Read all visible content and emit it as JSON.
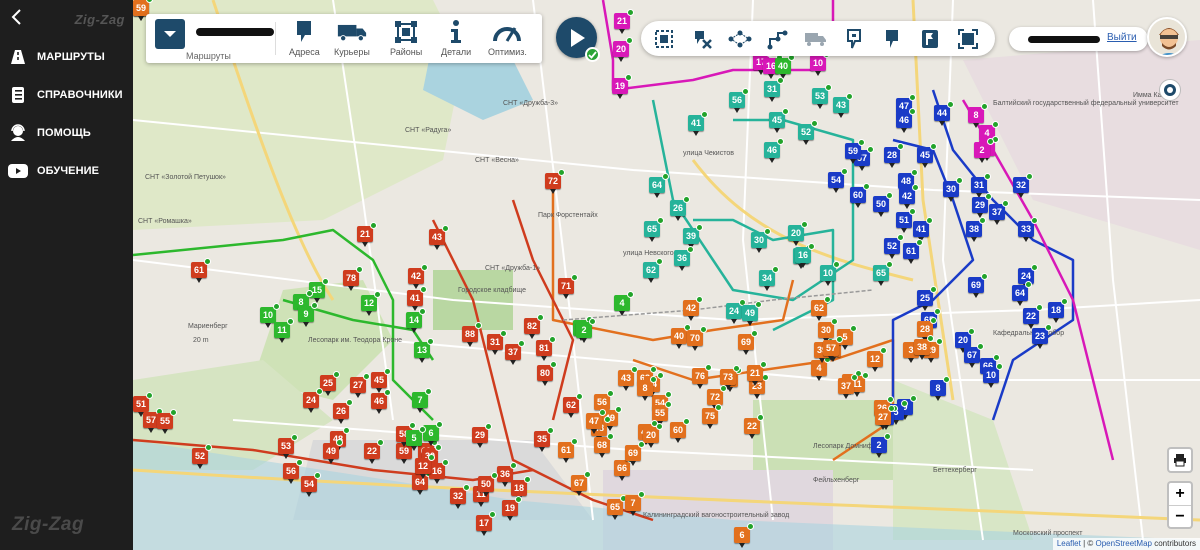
{
  "sidebar": {
    "brand_top": "Zig-Zag",
    "brand_bottom": "Zig-Zag",
    "items": [
      {
        "label": "МАРШРУТЫ",
        "icon": "road-sign-icon"
      },
      {
        "label": "СПРАВОЧНИКИ",
        "icon": "directory-icon"
      },
      {
        "label": "ПОМОЩЬ",
        "icon": "support-icon"
      },
      {
        "label": "ОБУЧЕНИЕ",
        "icon": "video-play-icon"
      }
    ]
  },
  "toolbar": {
    "routes_caption": "Маршруты",
    "buttons": [
      {
        "label": "Адреса",
        "icon": "address-pin-icon"
      },
      {
        "label": "Курьеры",
        "icon": "truck-icon"
      },
      {
        "label": "Районы",
        "icon": "district-icon"
      },
      {
        "label": "Детали",
        "icon": "info-icon"
      },
      {
        "label": "Оптимиз.",
        "icon": "speedometer-icon"
      }
    ]
  },
  "map_tools": [
    "select-area-icon",
    "remove-points-icon",
    "route-graph-icon",
    "route-path-icon",
    "truck-move-icon",
    "pin-outline-icon",
    "pin-filled-icon",
    "flag-icon",
    "fit-bounds-icon"
  ],
  "user": {
    "logout": "Выйти"
  },
  "colors": {
    "green": "#2db82d",
    "teal": "#26b39a",
    "orange": "#e2701e",
    "red": "#cf3c1e",
    "blue": "#1a3bc7",
    "magenta": "#d818b8",
    "panel": "#1e4a6a"
  },
  "attribution": {
    "leaflet": "Leaflet",
    "sep": " | © ",
    "osm": "OpenStreetMap",
    "suffix": " contributors"
  },
  "zoom": {
    "in": "+",
    "out": "−"
  },
  "map_labels": [
    {
      "t": "СНТ «Радуга»"
    },
    {
      "t": "СНТ «Весна»"
    },
    {
      "t": "СНТ «Дружба-1»"
    },
    {
      "t": "СНТ «Дружба-3»"
    },
    {
      "t": "СНТ «Ромашка»"
    },
    {
      "t": "СНТ «Золотой Петушок»"
    },
    {
      "t": "Мариенберг"
    },
    {
      "t": "20 m"
    },
    {
      "t": "Лесопарк им. Теодора Кроне"
    },
    {
      "t": "Городское кладбище"
    },
    {
      "t": "Парк Форстентайх"
    },
    {
      "t": "улица Чекистов"
    },
    {
      "t": "улица Невского"
    },
    {
      "t": "Лесопарк Домнифхоф"
    },
    {
      "t": "Фейльхенберг"
    },
    {
      "t": "Беттехерберг"
    },
    {
      "t": "Московский проспект"
    },
    {
      "t": "Калининградский вагоностроительный завод"
    },
    {
      "t": "Кафедральный собор"
    },
    {
      "t": "Балтийский государственный федеральный университет"
    },
    {
      "t": "Имма Канта"
    }
  ],
  "markers": [
    {
      "n": "21",
      "c": "magenta"
    },
    {
      "n": "20",
      "c": "magenta"
    },
    {
      "n": "19",
      "c": "magenta"
    },
    {
      "n": "17",
      "c": "magenta"
    },
    {
      "n": "16",
      "c": "magenta"
    },
    {
      "n": "10",
      "c": "magenta"
    },
    {
      "n": "40",
      "c": "green"
    },
    {
      "n": "31",
      "c": "teal"
    },
    {
      "n": "56",
      "c": "teal"
    },
    {
      "n": "53",
      "c": "teal"
    },
    {
      "n": "43",
      "c": "teal"
    },
    {
      "n": "41",
      "c": "teal"
    },
    {
      "n": "45",
      "c": "teal"
    },
    {
      "n": "52",
      "c": "teal"
    },
    {
      "n": "46",
      "c": "teal"
    },
    {
      "n": "64",
      "c": "teal"
    },
    {
      "n": "26",
      "c": "teal"
    },
    {
      "n": "65",
      "c": "teal"
    },
    {
      "n": "39",
      "c": "teal"
    },
    {
      "n": "36",
      "c": "teal"
    },
    {
      "n": "62",
      "c": "teal"
    },
    {
      "n": "24",
      "c": "teal"
    },
    {
      "n": "49",
      "c": "teal"
    },
    {
      "n": "30",
      "c": "teal"
    },
    {
      "n": "34",
      "c": "teal"
    },
    {
      "n": "15",
      "c": "teal"
    },
    {
      "n": "20",
      "c": "teal"
    },
    {
      "n": "16",
      "c": "teal"
    },
    {
      "n": "10",
      "c": "teal"
    },
    {
      "n": "65",
      "c": "teal"
    },
    {
      "n": "57",
      "c": "blue"
    },
    {
      "n": "59",
      "c": "blue"
    },
    {
      "n": "28",
      "c": "blue"
    },
    {
      "n": "44",
      "c": "blue"
    },
    {
      "n": "47",
      "c": "blue"
    },
    {
      "n": "46",
      "c": "blue"
    },
    {
      "n": "45",
      "c": "blue"
    },
    {
      "n": "54",
      "c": "blue"
    },
    {
      "n": "60",
      "c": "blue"
    },
    {
      "n": "48",
      "c": "blue"
    },
    {
      "n": "42",
      "c": "blue"
    },
    {
      "n": "50",
      "c": "blue"
    },
    {
      "n": "30",
      "c": "blue"
    },
    {
      "n": "31",
      "c": "blue"
    },
    {
      "n": "32",
      "c": "blue"
    },
    {
      "n": "29",
      "c": "blue"
    },
    {
      "n": "37",
      "c": "blue"
    },
    {
      "n": "51",
      "c": "blue"
    },
    {
      "n": "41",
      "c": "blue"
    },
    {
      "n": "38",
      "c": "blue"
    },
    {
      "n": "33",
      "c": "blue"
    },
    {
      "n": "52",
      "c": "blue"
    },
    {
      "n": "61",
      "c": "blue"
    },
    {
      "n": "24",
      "c": "blue"
    },
    {
      "n": "69",
      "c": "blue"
    },
    {
      "n": "64",
      "c": "blue"
    },
    {
      "n": "25",
      "c": "blue"
    },
    {
      "n": "22",
      "c": "blue"
    },
    {
      "n": "23",
      "c": "blue"
    },
    {
      "n": "65",
      "c": "blue"
    },
    {
      "n": "18",
      "c": "blue"
    },
    {
      "n": "20",
      "c": "blue"
    },
    {
      "n": "67",
      "c": "blue"
    },
    {
      "n": "66",
      "c": "blue"
    },
    {
      "n": "10",
      "c": "blue"
    },
    {
      "n": "8",
      "c": "blue"
    },
    {
      "n": "9",
      "c": "blue"
    },
    {
      "n": "5",
      "c": "blue"
    },
    {
      "n": "6",
      "c": "blue"
    },
    {
      "n": "2",
      "c": "blue"
    },
    {
      "n": "8",
      "c": "magenta"
    },
    {
      "n": "4",
      "c": "magenta"
    },
    {
      "n": "3",
      "c": "magenta"
    },
    {
      "n": "2",
      "c": "magenta"
    },
    {
      "n": "72",
      "c": "red"
    },
    {
      "n": "43",
      "c": "red"
    },
    {
      "n": "42",
      "c": "red"
    },
    {
      "n": "41",
      "c": "red"
    },
    {
      "n": "71",
      "c": "red"
    },
    {
      "n": "88",
      "c": "red"
    },
    {
      "n": "31",
      "c": "red"
    },
    {
      "n": "37",
      "c": "red"
    },
    {
      "n": "82",
      "c": "red"
    },
    {
      "n": "81",
      "c": "red"
    },
    {
      "n": "80",
      "c": "red"
    },
    {
      "n": "25",
      "c": "red"
    },
    {
      "n": "27",
      "c": "red"
    },
    {
      "n": "45",
      "c": "red"
    },
    {
      "n": "46",
      "c": "red"
    },
    {
      "n": "24",
      "c": "red"
    },
    {
      "n": "26",
      "c": "red"
    },
    {
      "n": "22",
      "c": "red"
    },
    {
      "n": "48",
      "c": "red"
    },
    {
      "n": "49",
      "c": "red"
    },
    {
      "n": "53",
      "c": "red"
    },
    {
      "n": "52",
      "c": "red"
    },
    {
      "n": "51",
      "c": "red"
    },
    {
      "n": "57",
      "c": "red"
    },
    {
      "n": "55",
      "c": "red"
    },
    {
      "n": "56",
      "c": "red"
    },
    {
      "n": "54",
      "c": "red"
    },
    {
      "n": "59",
      "c": "red"
    },
    {
      "n": "58",
      "c": "red"
    },
    {
      "n": "60",
      "c": "red"
    },
    {
      "n": "30",
      "c": "red"
    },
    {
      "n": "29",
      "c": "red"
    },
    {
      "n": "35",
      "c": "red"
    },
    {
      "n": "32",
      "c": "red"
    },
    {
      "n": "36",
      "c": "red"
    },
    {
      "n": "11",
      "c": "red"
    },
    {
      "n": "50",
      "c": "red"
    },
    {
      "n": "18",
      "c": "red"
    },
    {
      "n": "19",
      "c": "red"
    },
    {
      "n": "17",
      "c": "red"
    },
    {
      "n": "64",
      "c": "red"
    },
    {
      "n": "16",
      "c": "red"
    },
    {
      "n": "12",
      "c": "red"
    },
    {
      "n": "62",
      "c": "red"
    },
    {
      "n": "61",
      "c": "red"
    },
    {
      "n": "21",
      "c": "red"
    },
    {
      "n": "78",
      "c": "red"
    },
    {
      "n": "15",
      "c": "green"
    },
    {
      "n": "8",
      "c": "green"
    },
    {
      "n": "9",
      "c": "green"
    },
    {
      "n": "10",
      "c": "green"
    },
    {
      "n": "11",
      "c": "green"
    },
    {
      "n": "12",
      "c": "green"
    },
    {
      "n": "14",
      "c": "green"
    },
    {
      "n": "13",
      "c": "green"
    },
    {
      "n": "7",
      "c": "green"
    },
    {
      "n": "6",
      "c": "green"
    },
    {
      "n": "5",
      "c": "green"
    },
    {
      "n": "4",
      "c": "green"
    },
    {
      "n": "3",
      "c": "green"
    },
    {
      "n": "2",
      "c": "green"
    },
    {
      "n": "43",
      "c": "orange"
    },
    {
      "n": "42",
      "c": "orange"
    },
    {
      "n": "40",
      "c": "orange"
    },
    {
      "n": "70",
      "c": "orange"
    },
    {
      "n": "69",
      "c": "orange"
    },
    {
      "n": "74",
      "c": "orange"
    },
    {
      "n": "73",
      "c": "orange"
    },
    {
      "n": "76",
      "c": "orange"
    },
    {
      "n": "72",
      "c": "orange"
    },
    {
      "n": "75",
      "c": "orange"
    },
    {
      "n": "22",
      "c": "orange"
    },
    {
      "n": "23",
      "c": "orange"
    },
    {
      "n": "21",
      "c": "orange"
    },
    {
      "n": "63",
      "c": "orange"
    },
    {
      "n": "64",
      "c": "orange"
    },
    {
      "n": "54",
      "c": "orange"
    },
    {
      "n": "55",
      "c": "orange"
    },
    {
      "n": "56",
      "c": "orange"
    },
    {
      "n": "49",
      "c": "orange"
    },
    {
      "n": "48",
      "c": "orange"
    },
    {
      "n": "47",
      "c": "orange"
    },
    {
      "n": "46",
      "c": "orange"
    },
    {
      "n": "20",
      "c": "orange"
    },
    {
      "n": "60",
      "c": "orange"
    },
    {
      "n": "61",
      "c": "orange"
    },
    {
      "n": "67",
      "c": "orange"
    },
    {
      "n": "66",
      "c": "orange"
    },
    {
      "n": "68",
      "c": "orange"
    },
    {
      "n": "69",
      "c": "orange"
    },
    {
      "n": "65",
      "c": "orange"
    },
    {
      "n": "7",
      "c": "orange"
    },
    {
      "n": "6",
      "c": "orange"
    },
    {
      "n": "8",
      "c": "orange"
    },
    {
      "n": "10",
      "c": "orange"
    },
    {
      "n": "11",
      "c": "orange"
    },
    {
      "n": "12",
      "c": "orange"
    },
    {
      "n": "26",
      "c": "orange"
    },
    {
      "n": "27",
      "c": "orange"
    },
    {
      "n": "28",
      "c": "orange"
    },
    {
      "n": "29",
      "c": "orange"
    },
    {
      "n": "3",
      "c": "orange"
    },
    {
      "n": "4",
      "c": "orange"
    },
    {
      "n": "2",
      "c": "orange"
    },
    {
      "n": "39",
      "c": "orange"
    },
    {
      "n": "38",
      "c": "orange"
    },
    {
      "n": "37",
      "c": "orange"
    },
    {
      "n": "30",
      "c": "orange"
    },
    {
      "n": "5",
      "c": "orange"
    },
    {
      "n": "57",
      "c": "orange"
    },
    {
      "n": "62",
      "c": "orange"
    },
    {
      "n": "58",
      "c": "orange"
    },
    {
      "n": "59",
      "c": "orange"
    }
  ]
}
